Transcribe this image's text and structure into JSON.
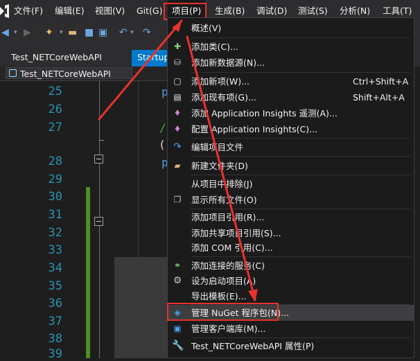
{
  "menubar": {
    "items": [
      {
        "label": "文件(F)"
      },
      {
        "label": "编辑(E)"
      },
      {
        "label": "视图(V)"
      },
      {
        "label": "Git(G)"
      },
      {
        "label": "项目(P)"
      },
      {
        "label": "生成(B)"
      },
      {
        "label": "调试(D)"
      },
      {
        "label": "测试(S)"
      },
      {
        "label": "分析(N)"
      },
      {
        "label": "工具(T)"
      }
    ]
  },
  "tabs": {
    "inactive": "Test_NETCoreWebAPI",
    "active": "Startup.cs"
  },
  "navbar": {
    "project": "Test_NETCoreWebAPI"
  },
  "editor": {
    "line_numbers": [
      "25",
      "26",
      "27",
      "28",
      "29",
      "30",
      "31",
      "32",
      "33",
      "34",
      "35",
      "36",
      "37",
      "38",
      "39"
    ]
  },
  "project_menu": {
    "items": [
      {
        "label": "概述(V)"
      },
      {
        "label": "添加类(C)..."
      },
      {
        "label": "添加新数据源(N)..."
      },
      {
        "label": "添加新项(W)...",
        "shortcut": "Ctrl+Shift+A"
      },
      {
        "label": "添加现有项(G)...",
        "shortcut": "Shift+Alt+A"
      },
      {
        "label": "添加 Application Insights 遥测(A)..."
      },
      {
        "label": "配置 Application Insights(C)..."
      },
      {
        "label": "编辑项目文件"
      },
      {
        "label": "新建文件夹(D)"
      },
      {
        "label": "从项目中排除(J)"
      },
      {
        "label": "显示所有文件(O)"
      },
      {
        "label": "添加项目引用(R)..."
      },
      {
        "label": "添加共享项目引用(S)..."
      },
      {
        "label": "添加 COM 引用(C)..."
      },
      {
        "label": "添加连接的服务(C)"
      },
      {
        "label": "设为启动项目(A)"
      },
      {
        "label": "导出模板(E)..."
      },
      {
        "label": "管理 NuGet 程序包(N)..."
      },
      {
        "label": "管理客户端库(M)..."
      },
      {
        "label": "Test_NETCoreWebAPI 属性(P)"
      }
    ]
  },
  "colors": {
    "accent": "#007acc",
    "highlight_box": "#e8322c",
    "line_number": "#2b91af",
    "menu_bg": "#1b1b1c"
  }
}
